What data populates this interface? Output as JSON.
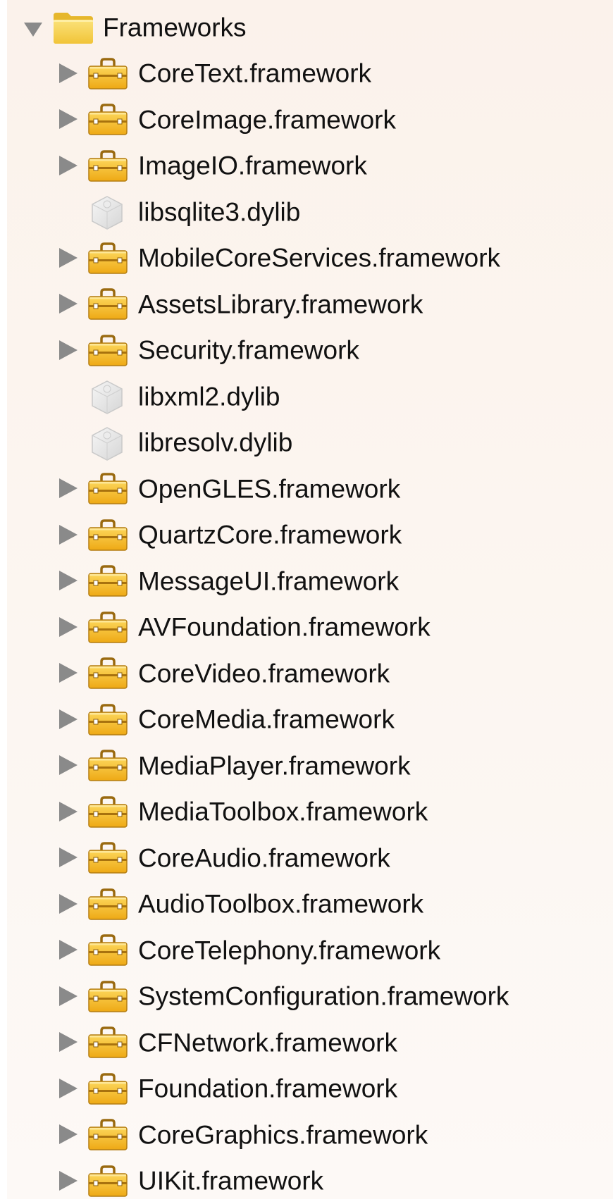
{
  "tree": {
    "root": {
      "label": "Frameworks",
      "icon": "folder-icon",
      "expanded": true
    },
    "items": [
      {
        "label": "CoreText.framework",
        "icon": "framework-toolbox-icon",
        "expandable": true
      },
      {
        "label": "CoreImage.framework",
        "icon": "framework-toolbox-icon",
        "expandable": true
      },
      {
        "label": "ImageIO.framework",
        "icon": "framework-toolbox-icon",
        "expandable": true
      },
      {
        "label": "libsqlite3.dylib",
        "icon": "dylib-icon",
        "expandable": false
      },
      {
        "label": "MobileCoreServices.framework",
        "icon": "framework-toolbox-icon",
        "expandable": true
      },
      {
        "label": "AssetsLibrary.framework",
        "icon": "framework-toolbox-icon",
        "expandable": true
      },
      {
        "label": "Security.framework",
        "icon": "framework-toolbox-icon",
        "expandable": true
      },
      {
        "label": "libxml2.dylib",
        "icon": "dylib-icon",
        "expandable": false
      },
      {
        "label": "libresolv.dylib",
        "icon": "dylib-icon",
        "expandable": false
      },
      {
        "label": "OpenGLES.framework",
        "icon": "framework-toolbox-icon",
        "expandable": true
      },
      {
        "label": "QuartzCore.framework",
        "icon": "framework-toolbox-icon",
        "expandable": true
      },
      {
        "label": "MessageUI.framework",
        "icon": "framework-toolbox-icon",
        "expandable": true
      },
      {
        "label": "AVFoundation.framework",
        "icon": "framework-toolbox-icon",
        "expandable": true
      },
      {
        "label": "CoreVideo.framework",
        "icon": "framework-toolbox-icon",
        "expandable": true
      },
      {
        "label": "CoreMedia.framework",
        "icon": "framework-toolbox-icon",
        "expandable": true
      },
      {
        "label": "MediaPlayer.framework",
        "icon": "framework-toolbox-icon",
        "expandable": true
      },
      {
        "label": "MediaToolbox.framework",
        "icon": "framework-toolbox-icon",
        "expandable": true
      },
      {
        "label": "CoreAudio.framework",
        "icon": "framework-toolbox-icon",
        "expandable": true
      },
      {
        "label": "AudioToolbox.framework",
        "icon": "framework-toolbox-icon",
        "expandable": true
      },
      {
        "label": "CoreTelephony.framework",
        "icon": "framework-toolbox-icon",
        "expandable": true
      },
      {
        "label": "SystemConfiguration.framework",
        "icon": "framework-toolbox-icon",
        "expandable": true
      },
      {
        "label": "CFNetwork.framework",
        "icon": "framework-toolbox-icon",
        "expandable": true
      },
      {
        "label": "Foundation.framework",
        "icon": "framework-toolbox-icon",
        "expandable": true
      },
      {
        "label": "CoreGraphics.framework",
        "icon": "framework-toolbox-icon",
        "expandable": true
      },
      {
        "label": "UIKit.framework",
        "icon": "framework-toolbox-icon",
        "expandable": true
      }
    ]
  },
  "colors": {
    "panel_background": "#fbf2eb",
    "text": "#111111",
    "disclosure_triangle": "#8a8a8a",
    "folder_yellow": "#f6d04a",
    "toolbox_orange": "#f2b51e",
    "dylib_gray": "#e4e4e4"
  }
}
